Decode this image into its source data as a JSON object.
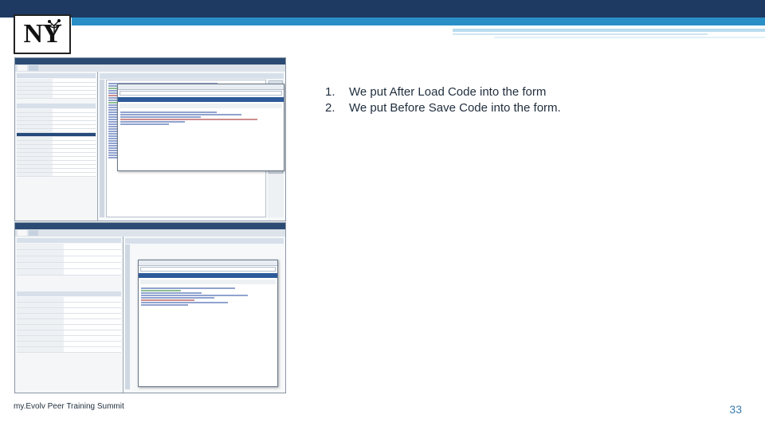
{
  "logo": {
    "text": "NY"
  },
  "notes": [
    {
      "num": "1.",
      "text": "We put After Load Code into the form"
    },
    {
      "num": "2.",
      "text": "We put Before Save Code into the form."
    }
  ],
  "footer": {
    "text": "my.Evolv Peer Training Summit"
  },
  "page_number": "33",
  "colors": {
    "banner_dark": "#1e3a63",
    "banner_light": "#2a8fc7",
    "page_number": "#3a7db1"
  }
}
